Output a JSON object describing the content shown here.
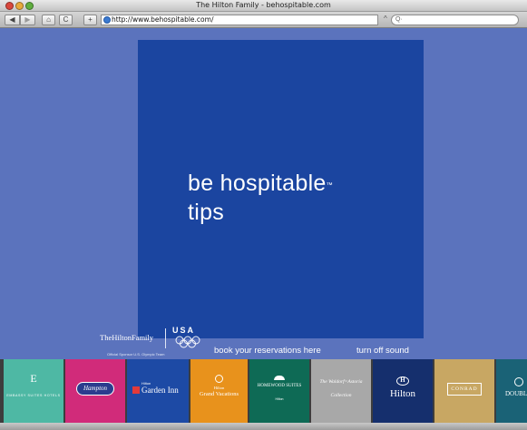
{
  "window": {
    "title": "The Hilton Family - behospitable.com"
  },
  "toolbar": {
    "back_label": "◀",
    "forward_label": "▶",
    "home_label": "⌂",
    "reload_label": "C",
    "add_label": "+",
    "url": "http://www.behospitable.com/",
    "url_suffix": "^",
    "search_placeholder": "Q·"
  },
  "main": {
    "headline_line1": "be hospitable",
    "headline_tm": "™",
    "headline_line2": "tips",
    "sponsor_logo": "TheHiltonFamily",
    "sponsor_usa": "USA",
    "sponsor_caption": "Official Sponsor U.S. Olympic Team",
    "link_reservations": "book your reservations here",
    "link_sound": "turn off sound"
  },
  "brands": [
    {
      "name": "EMBASSY SUITES HOTELS",
      "mark": "E",
      "bg": "#4eb8a4"
    },
    {
      "name": "Hampton",
      "mark": "",
      "bg": "#d12b7a"
    },
    {
      "name": "Garden Inn",
      "mark": "Hilton",
      "bg": "#1d4aa5"
    },
    {
      "name": "Grand Vacations",
      "mark": "Hilton",
      "bg": "#e8921c"
    },
    {
      "name": "HOMEWOOD SUITES",
      "mark": "Hilton",
      "bg": "#0e6a55"
    },
    {
      "name": "Collection",
      "mark": "The Waldorf=Astoria",
      "bg": "#a8a8a8"
    },
    {
      "name": "Hilton",
      "mark": "H",
      "bg": "#152f6d"
    },
    {
      "name": "CONRAD",
      "mark": "",
      "bg": "#c8a763"
    },
    {
      "name": "DOUBLE",
      "mark": "",
      "bg": "#1a6276"
    }
  ],
  "colors": {
    "page_bg": "#5b73bd",
    "panel_bg": "#1b45a0"
  }
}
